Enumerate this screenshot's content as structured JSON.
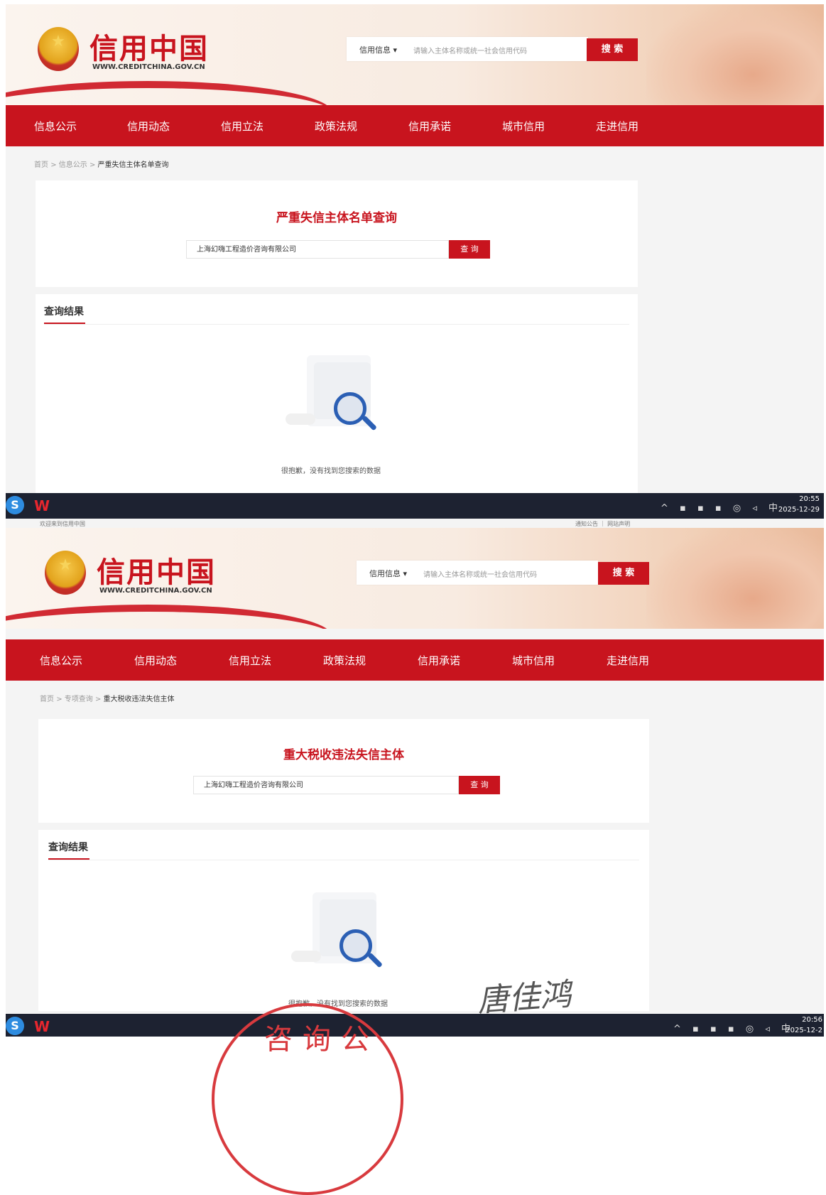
{
  "site": {
    "logo_title": "信用中国",
    "logo_url": "WWW.CREDITCHINA.GOV.CN",
    "search_category": "信用信息 ▾",
    "search_placeholder": "请输入主体名称或统一社会信用代码",
    "search_button": "搜 索",
    "nav": [
      "信息公示",
      "信用动态",
      "信用立法",
      "政策法规",
      "信用承诺",
      "城市信用",
      "走进信用"
    ]
  },
  "shot1": {
    "breadcrumb": {
      "home": "首页",
      "sep": ">",
      "parent": "信息公示",
      "current": "严重失信主体名单查询"
    },
    "card_title": "严重失信主体名单查询",
    "query_value": "上海幻嗨工程造价咨询有限公司",
    "query_button": "查 询",
    "results_title": "查询结果",
    "empty_text": "很抱歉，没有找到您搜索的数据",
    "clock": {
      "time": "20:55",
      "date": "2025-12-29"
    }
  },
  "shot2": {
    "topbar_left": "欢迎来到信用中国",
    "topbar_right": "通知公告 ｜ 网站声明",
    "breadcrumb": {
      "home": "首页",
      "sep": ">",
      "parent": "专项查询",
      "current": "重大税收违法失信主体"
    },
    "card_title": "重大税收违法失信主体",
    "query_value": "上海幻嗨工程造价咨询有限公司",
    "query_button": "查 询",
    "results_title": "查询结果",
    "empty_text": "很抱歉，没有找到您搜索的数据",
    "clock": {
      "time": "20:56",
      "date": "2025-12-2"
    }
  },
  "taskbar": {
    "start_glyph": "S",
    "wps_glyph": "W",
    "tray": "^ ▪ ▪ ▪ ◎ ◃ 中"
  },
  "annotations": {
    "signature": "唐佳鸿",
    "stamp_text": "咨询公"
  }
}
